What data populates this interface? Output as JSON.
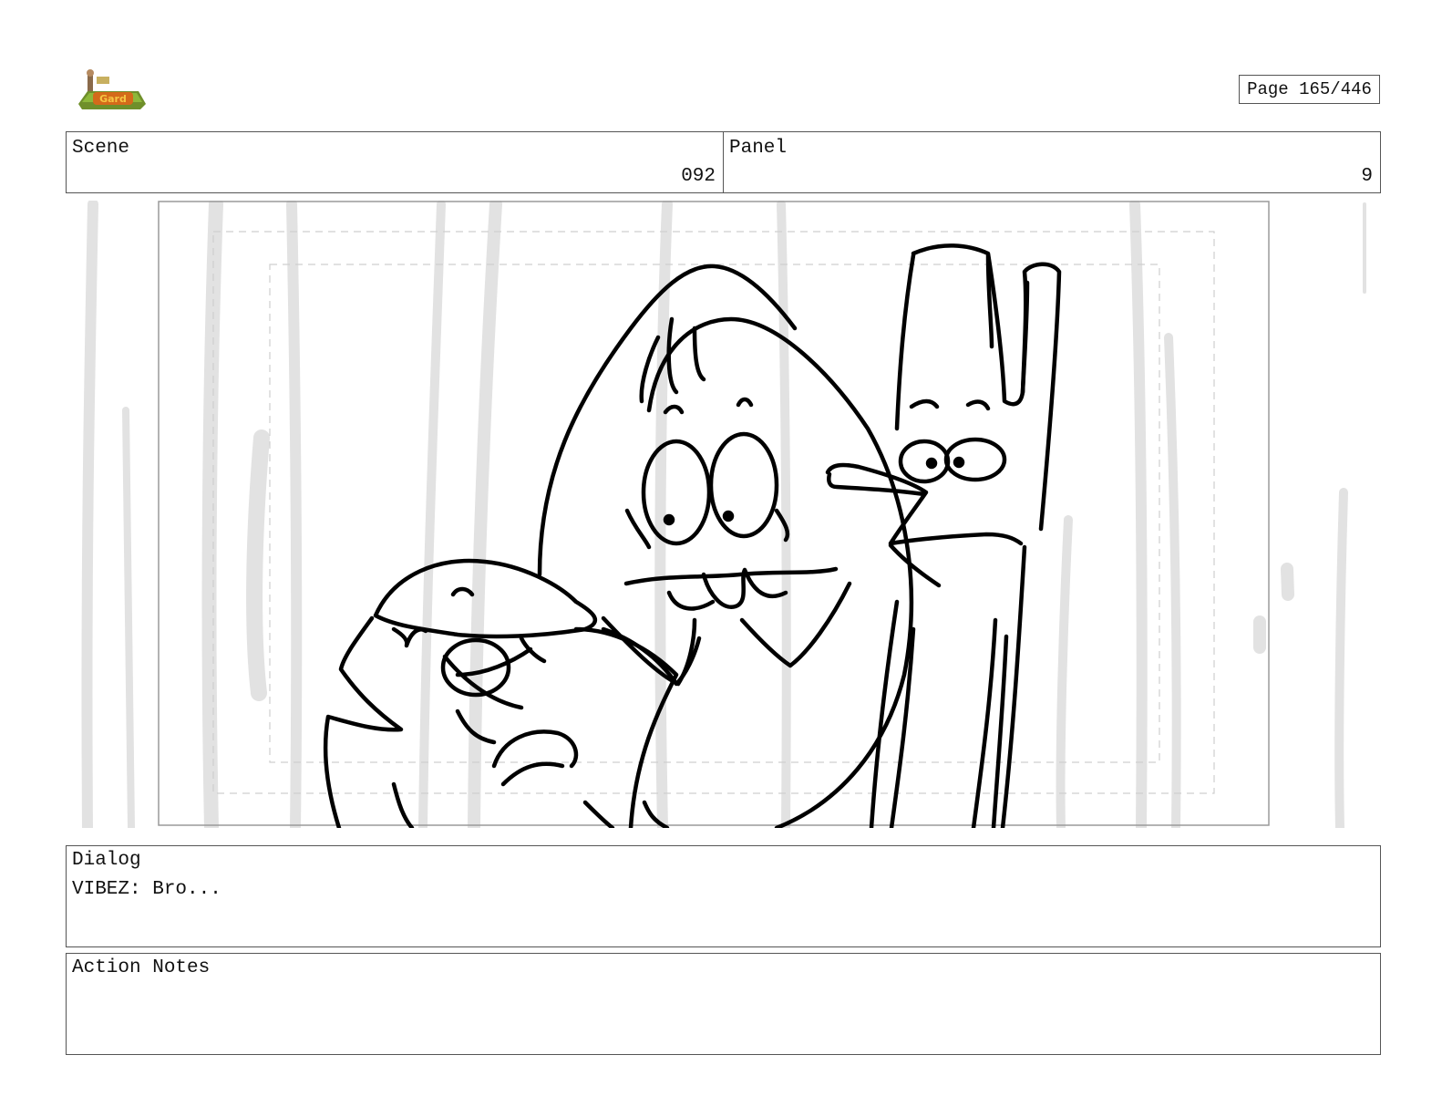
{
  "header": {
    "logo_icon": "show-logo-icon",
    "page_label": "Page 165/446"
  },
  "scene": {
    "label": "Scene",
    "value": "092"
  },
  "panel": {
    "label": "Panel",
    "value": "9"
  },
  "artwork": {
    "description_icon": "storyboard-sketch-panel",
    "colors": {
      "ink": "#000000",
      "background_stroke": "#e2e2e2",
      "safe_frame": "#cfcfcf"
    }
  },
  "dialog": {
    "label": "Dialog",
    "text": "VIBEZ: Bro..."
  },
  "action_notes": {
    "label": "Action Notes",
    "text": ""
  }
}
